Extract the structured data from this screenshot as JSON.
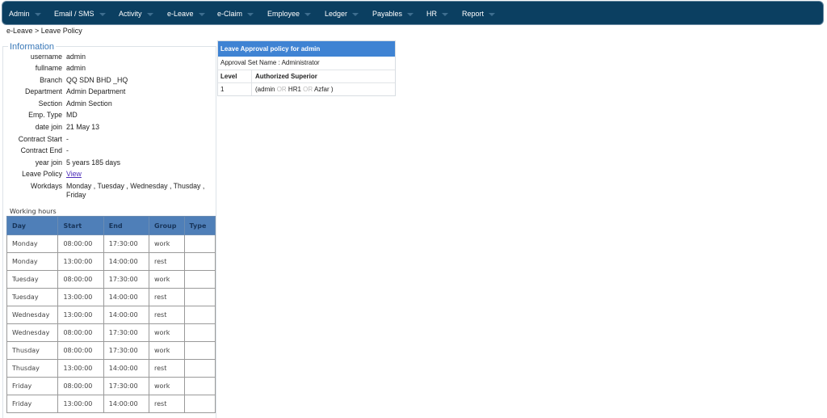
{
  "nav": {
    "items": [
      "Admin",
      "Email / SMS",
      "Activity",
      "e-Leave",
      "e-Claim",
      "Employee",
      "Ledger",
      "Payables",
      "HR",
      "Report"
    ]
  },
  "breadcrumb": "e-Leave > Leave Policy",
  "info": {
    "legend": "Information",
    "rows": [
      {
        "label": "username",
        "value": "admin"
      },
      {
        "label": "fullname",
        "value": "admin"
      },
      {
        "label": "Branch",
        "value": "QQ SDN BHD _HQ"
      },
      {
        "label": "Department",
        "value": "Admin Department"
      },
      {
        "label": "Section",
        "value": "Admin Section"
      },
      {
        "label": "Emp. Type",
        "value": "MD"
      },
      {
        "label": "date join",
        "value": "21 May 13"
      },
      {
        "label": "Contract Start",
        "value": "-"
      },
      {
        "label": "Contract End",
        "value": "-"
      },
      {
        "label": "year join",
        "value": "5 years 185 days"
      },
      {
        "label": "Leave Policy",
        "value": "View"
      },
      {
        "label": "Workdays",
        "value": "Monday , Tuesday , Wednesday , Thusday , Friday"
      }
    ]
  },
  "working_hours": {
    "title": "Working hours",
    "columns": [
      "Day",
      "Start",
      "End",
      "Group",
      "Type"
    ],
    "rows": [
      [
        "Monday",
        "08:00:00",
        "17:30:00",
        "work",
        ""
      ],
      [
        "Monday",
        "13:00:00",
        "14:00:00",
        "rest",
        ""
      ],
      [
        "Tuesday",
        "08:00:00",
        "17:30:00",
        "work",
        ""
      ],
      [
        "Tuesday",
        "13:00:00",
        "14:00:00",
        "rest",
        ""
      ],
      [
        "Wednesday",
        "13:00:00",
        "14:00:00",
        "rest",
        ""
      ],
      [
        "Wednesday",
        "08:00:00",
        "17:30:00",
        "work",
        ""
      ],
      [
        "Thusday",
        "08:00:00",
        "17:30:00",
        "work",
        ""
      ],
      [
        "Thusday",
        "13:00:00",
        "14:00:00",
        "rest",
        ""
      ],
      [
        "Friday",
        "08:00:00",
        "17:30:00",
        "work",
        ""
      ],
      [
        "Friday",
        "13:00:00",
        "14:00:00",
        "rest",
        ""
      ]
    ]
  },
  "approval": {
    "title": "Leave Approval policy for admin",
    "set_name": "Approval Set Name : Administrator",
    "col_level": "Level",
    "col_superior": "Authorized Superior",
    "rows": [
      {
        "level": "1",
        "open": "(admin",
        "or1": "OR",
        "s2": "HR1",
        "or2": "OR",
        "s3": "Azfar )"
      }
    ]
  }
}
